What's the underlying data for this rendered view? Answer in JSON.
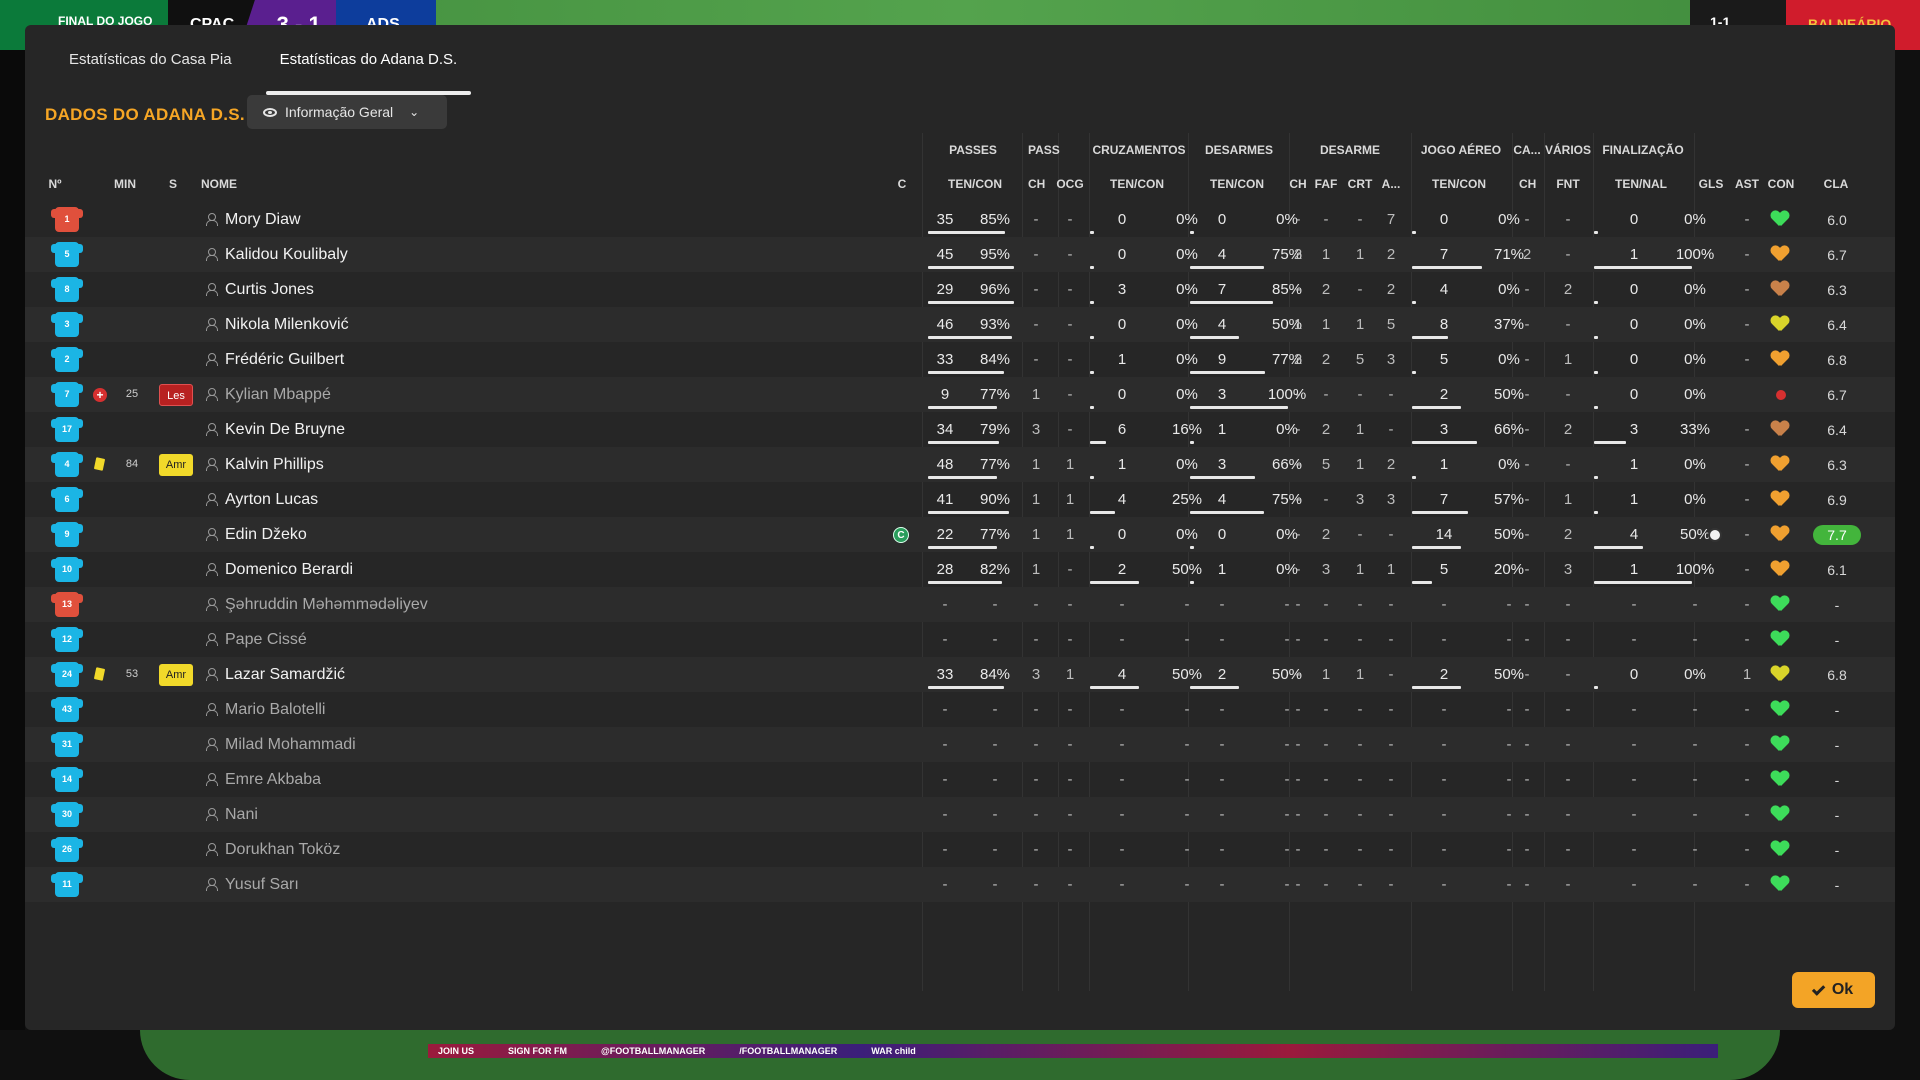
{
  "topbar": {
    "status": "FINAL DO JOGO",
    "home": "CPAC",
    "score": "3 - 1",
    "away": "ADS",
    "right_score": "1-1",
    "room": "BALNEÁRIO"
  },
  "tabs": [
    {
      "label": "Estatísticas do Casa Pia",
      "active": false
    },
    {
      "label": "Estatísticas do Adana D.S.",
      "active": true
    }
  ],
  "section_title": "DADOS DO ADANA D.S.",
  "view_select": "Informação Geral",
  "group_headers": [
    "PASSES",
    "PASSE",
    "CRUZAMENTOS",
    "DESARMES",
    "DESARME",
    "JOGO AÉREO",
    "CA...",
    "VÁRIOS",
    "FINALIZAÇÃO"
  ],
  "column_headers": {
    "num": "Nº",
    "min": "MIN",
    "s": "S",
    "nome": "NOME",
    "c": "C",
    "passes": "TEN/CON",
    "passe_ch": "CH",
    "passe_ocg": "OCG",
    "cruz": "TEN/CON",
    "desarmes": "TEN/CON",
    "desarme_ch": "CH",
    "desarme_faf": "FAF",
    "desarme_crt": "CRT",
    "desarme_a": "A...",
    "aereo": "TEN/CON",
    "ca_ch": "CH",
    "varios_fnt": "FNT",
    "fin": "TEN/NAL",
    "gls": "GLS",
    "ast": "AST",
    "con": "CON",
    "cla": "CLA"
  },
  "players": [
    {
      "num": "1",
      "gk": true,
      "min": "",
      "status": "",
      "name": "Mory Diaw",
      "dim": false,
      "captain": false,
      "pas": [
        "35",
        "85%"
      ],
      "pas_bar": 0.85,
      "ch": "-",
      "ocg": "-",
      "cru": [
        "0",
        "0%"
      ],
      "cru_bar": 0,
      "des": [
        "0",
        "0%"
      ],
      "des_bar": 0,
      "dch": "-",
      "faf": "-",
      "crt": "-",
      "da": "7",
      "aer": [
        "0",
        "0%"
      ],
      "aer_bar": 0,
      "cach": "-",
      "fnt": "-",
      "fin": [
        "0",
        "0%"
      ],
      "fin_bar": 0,
      "gls": "",
      "ast": "-",
      "con": "green",
      "cla": "6.0",
      "top": false
    },
    {
      "num": "5",
      "gk": false,
      "min": "",
      "status": "",
      "name": "Kalidou Koulibaly",
      "dim": false,
      "captain": false,
      "pas": [
        "45",
        "95%"
      ],
      "pas_bar": 0.95,
      "ch": "-",
      "ocg": "-",
      "cru": [
        "0",
        "0%"
      ],
      "cru_bar": 0,
      "des": [
        "4",
        "75%"
      ],
      "des_bar": 0.75,
      "dch": "2",
      "faf": "1",
      "crt": "1",
      "da": "2",
      "aer": [
        "7",
        "71%"
      ],
      "aer_bar": 0.71,
      "cach": "2",
      "fnt": "-",
      "fin": [
        "1",
        "100%"
      ],
      "fin_bar": 1,
      "gls": "",
      "ast": "-",
      "con": "orange",
      "cla": "6.7",
      "top": false
    },
    {
      "num": "8",
      "gk": false,
      "min": "",
      "status": "",
      "name": "Curtis Jones",
      "dim": false,
      "captain": false,
      "pas": [
        "29",
        "96%"
      ],
      "pas_bar": 0.96,
      "ch": "-",
      "ocg": "-",
      "cru": [
        "3",
        "0%"
      ],
      "cru_bar": 0,
      "des": [
        "7",
        "85%"
      ],
      "des_bar": 0.85,
      "dch": "-",
      "faf": "2",
      "crt": "-",
      "da": "2",
      "aer": [
        "4",
        "0%"
      ],
      "aer_bar": 0,
      "cach": "-",
      "fnt": "2",
      "fin": [
        "0",
        "0%"
      ],
      "fin_bar": 0,
      "gls": "",
      "ast": "-",
      "con": "brown",
      "cla": "6.3",
      "top": false
    },
    {
      "num": "3",
      "gk": false,
      "min": "",
      "status": "",
      "name": "Nikola Milenković",
      "dim": false,
      "captain": false,
      "pas": [
        "46",
        "93%"
      ],
      "pas_bar": 0.93,
      "ch": "-",
      "ocg": "-",
      "cru": [
        "0",
        "0%"
      ],
      "cru_bar": 0,
      "des": [
        "4",
        "50%"
      ],
      "des_bar": 0.5,
      "dch": "1",
      "faf": "1",
      "crt": "1",
      "da": "5",
      "aer": [
        "8",
        "37%"
      ],
      "aer_bar": 0.37,
      "cach": "-",
      "fnt": "-",
      "fin": [
        "0",
        "0%"
      ],
      "fin_bar": 0,
      "gls": "",
      "ast": "-",
      "con": "yellow",
      "cla": "6.4",
      "top": false
    },
    {
      "num": "2",
      "gk": false,
      "min": "",
      "status": "",
      "name": "Frédéric Guilbert",
      "dim": false,
      "captain": false,
      "pas": [
        "33",
        "84%"
      ],
      "pas_bar": 0.84,
      "ch": "-",
      "ocg": "-",
      "cru": [
        "1",
        "0%"
      ],
      "cru_bar": 0,
      "des": [
        "9",
        "77%"
      ],
      "des_bar": 0.77,
      "dch": "2",
      "faf": "2",
      "crt": "5",
      "da": "3",
      "aer": [
        "5",
        "0%"
      ],
      "aer_bar": 0,
      "cach": "-",
      "fnt": "1",
      "fin": [
        "0",
        "0%"
      ],
      "fin_bar": 0,
      "gls": "",
      "ast": "-",
      "con": "orange",
      "cla": "6.8",
      "top": false
    },
    {
      "num": "7",
      "gk": false,
      "min": "25",
      "status": "les",
      "name": "Kylian Mbappé",
      "dim": true,
      "captain": false,
      "pas": [
        "9",
        "77%"
      ],
      "pas_bar": 0.77,
      "ch": "1",
      "ocg": "-",
      "cru": [
        "0",
        "0%"
      ],
      "cru_bar": 0,
      "des": [
        "3",
        "100%"
      ],
      "des_bar": 1,
      "dch": "-",
      "faf": "-",
      "crt": "-",
      "da": "-",
      "aer": [
        "2",
        "50%"
      ],
      "aer_bar": 0.5,
      "cach": "-",
      "fnt": "-",
      "fin": [
        "0",
        "0%"
      ],
      "fin_bar": 0,
      "gls": "",
      "ast": "",
      "con": "injured",
      "cla": "6.7",
      "top": false
    },
    {
      "num": "17",
      "gk": false,
      "min": "",
      "status": "",
      "name": "Kevin De Bruyne",
      "dim": false,
      "captain": false,
      "pas": [
        "34",
        "79%"
      ],
      "pas_bar": 0.79,
      "ch": "3",
      "ocg": "-",
      "cru": [
        "6",
        "16%"
      ],
      "cru_bar": 0.16,
      "des": [
        "1",
        "0%"
      ],
      "des_bar": 0,
      "dch": "-",
      "faf": "2",
      "crt": "1",
      "da": "-",
      "aer": [
        "3",
        "66%"
      ],
      "aer_bar": 0.66,
      "cach": "-",
      "fnt": "2",
      "fin": [
        "3",
        "33%"
      ],
      "fin_bar": 0.33,
      "gls": "",
      "ast": "-",
      "con": "brown",
      "cla": "6.4",
      "top": false
    },
    {
      "num": "4",
      "gk": false,
      "min": "84",
      "status": "amr",
      "name": "Kalvin Phillips",
      "dim": false,
      "captain": false,
      "pas": [
        "48",
        "77%"
      ],
      "pas_bar": 0.77,
      "ch": "1",
      "ocg": "1",
      "cru": [
        "1",
        "0%"
      ],
      "cru_bar": 0,
      "des": [
        "3",
        "66%"
      ],
      "des_bar": 0.66,
      "dch": "-",
      "faf": "5",
      "crt": "1",
      "da": "2",
      "aer": [
        "1",
        "0%"
      ],
      "aer_bar": 0,
      "cach": "-",
      "fnt": "-",
      "fin": [
        "1",
        "0%"
      ],
      "fin_bar": 0,
      "gls": "",
      "ast": "-",
      "con": "orange",
      "cla": "6.3",
      "top": false
    },
    {
      "num": "6",
      "gk": false,
      "min": "",
      "status": "",
      "name": "Ayrton Lucas",
      "dim": false,
      "captain": false,
      "pas": [
        "41",
        "90%"
      ],
      "pas_bar": 0.9,
      "ch": "1",
      "ocg": "1",
      "cru": [
        "4",
        "25%"
      ],
      "cru_bar": 0.25,
      "des": [
        "4",
        "75%"
      ],
      "des_bar": 0.75,
      "dch": "-",
      "faf": "-",
      "crt": "3",
      "da": "3",
      "aer": [
        "7",
        "57%"
      ],
      "aer_bar": 0.57,
      "cach": "-",
      "fnt": "1",
      "fin": [
        "1",
        "0%"
      ],
      "fin_bar": 0,
      "gls": "",
      "ast": "-",
      "con": "orange",
      "cla": "6.9",
      "top": false
    },
    {
      "num": "9",
      "gk": false,
      "min": "",
      "status": "",
      "name": "Edin Džeko",
      "dim": false,
      "captain": true,
      "pas": [
        "22",
        "77%"
      ],
      "pas_bar": 0.77,
      "ch": "1",
      "ocg": "1",
      "cru": [
        "0",
        "0%"
      ],
      "cru_bar": 0,
      "des": [
        "0",
        "0%"
      ],
      "des_bar": 0,
      "dch": "-",
      "faf": "2",
      "crt": "-",
      "da": "-",
      "aer": [
        "14",
        "50%"
      ],
      "aer_bar": 0.5,
      "cach": "-",
      "fnt": "2",
      "fin": [
        "4",
        "50%"
      ],
      "fin_bar": 0.5,
      "gls": "ball",
      "ast": "-",
      "con": "orange",
      "cla": "7.7",
      "top": true
    },
    {
      "num": "10",
      "gk": false,
      "min": "",
      "status": "",
      "name": "Domenico Berardi",
      "dim": false,
      "captain": false,
      "pas": [
        "28",
        "82%"
      ],
      "pas_bar": 0.82,
      "ch": "1",
      "ocg": "-",
      "cru": [
        "2",
        "50%"
      ],
      "cru_bar": 0.5,
      "des": [
        "1",
        "0%"
      ],
      "des_bar": 0,
      "dch": "-",
      "faf": "3",
      "crt": "1",
      "da": "1",
      "aer": [
        "5",
        "20%"
      ],
      "aer_bar": 0.2,
      "cach": "-",
      "fnt": "3",
      "fin": [
        "1",
        "100%"
      ],
      "fin_bar": 1,
      "gls": "",
      "ast": "-",
      "con": "orange",
      "cla": "6.1",
      "top": false
    },
    {
      "num": "13",
      "gk": true,
      "min": "",
      "status": "",
      "name": "Şəhruddin Məhəmmədəliyev",
      "dim": true,
      "captain": false,
      "pas": [
        "-",
        "-"
      ],
      "pas_bar": 0,
      "ch": "-",
      "ocg": "-",
      "cru": [
        "-",
        "-"
      ],
      "cru_bar": 0,
      "des": [
        "-",
        "-"
      ],
      "des_bar": 0,
      "dch": "-",
      "faf": "-",
      "crt": "-",
      "da": "-",
      "aer": [
        "-",
        "-"
      ],
      "aer_bar": 0,
      "cach": "-",
      "fnt": "-",
      "fin": [
        "-",
        "-"
      ],
      "fin_bar": 0,
      "gls": "",
      "ast": "-",
      "con": "green",
      "cla": "-",
      "top": false
    },
    {
      "num": "12",
      "gk": false,
      "min": "",
      "status": "",
      "name": "Pape Cissé",
      "dim": true,
      "captain": false,
      "pas": [
        "-",
        "-"
      ],
      "pas_bar": 0,
      "ch": "-",
      "ocg": "-",
      "cru": [
        "-",
        "-"
      ],
      "cru_bar": 0,
      "des": [
        "-",
        "-"
      ],
      "des_bar": 0,
      "dch": "-",
      "faf": "-",
      "crt": "-",
      "da": "-",
      "aer": [
        "-",
        "-"
      ],
      "aer_bar": 0,
      "cach": "-",
      "fnt": "-",
      "fin": [
        "-",
        "-"
      ],
      "fin_bar": 0,
      "gls": "",
      "ast": "-",
      "con": "green",
      "cla": "-",
      "top": false
    },
    {
      "num": "24",
      "gk": false,
      "min": "53",
      "status": "amr",
      "name": "Lazar Samardžić",
      "dim": false,
      "captain": false,
      "pas": [
        "33",
        "84%"
      ],
      "pas_bar": 0.84,
      "ch": "3",
      "ocg": "1",
      "cru": [
        "4",
        "50%"
      ],
      "cru_bar": 0.5,
      "des": [
        "2",
        "50%"
      ],
      "des_bar": 0.5,
      "dch": "-",
      "faf": "1",
      "crt": "1",
      "da": "-",
      "aer": [
        "2",
        "50%"
      ],
      "aer_bar": 0.5,
      "cach": "-",
      "fnt": "-",
      "fin": [
        "0",
        "0%"
      ],
      "fin_bar": 0,
      "gls": "",
      "ast": "1",
      "con": "yellow",
      "cla": "6.8",
      "top": false
    },
    {
      "num": "43",
      "gk": false,
      "min": "",
      "status": "",
      "name": "Mario Balotelli",
      "dim": true,
      "captain": false,
      "pas": [
        "-",
        "-"
      ],
      "pas_bar": 0,
      "ch": "-",
      "ocg": "-",
      "cru": [
        "-",
        "-"
      ],
      "cru_bar": 0,
      "des": [
        "-",
        "-"
      ],
      "des_bar": 0,
      "dch": "-",
      "faf": "-",
      "crt": "-",
      "da": "-",
      "aer": [
        "-",
        "-"
      ],
      "aer_bar": 0,
      "cach": "-",
      "fnt": "-",
      "fin": [
        "-",
        "-"
      ],
      "fin_bar": 0,
      "gls": "",
      "ast": "-",
      "con": "green",
      "cla": "-",
      "top": false
    },
    {
      "num": "31",
      "gk": false,
      "min": "",
      "status": "",
      "name": "Milad Mohammadi",
      "dim": true,
      "captain": false,
      "pas": [
        "-",
        "-"
      ],
      "pas_bar": 0,
      "ch": "-",
      "ocg": "-",
      "cru": [
        "-",
        "-"
      ],
      "cru_bar": 0,
      "des": [
        "-",
        "-"
      ],
      "des_bar": 0,
      "dch": "-",
      "faf": "-",
      "crt": "-",
      "da": "-",
      "aer": [
        "-",
        "-"
      ],
      "aer_bar": 0,
      "cach": "-",
      "fnt": "-",
      "fin": [
        "-",
        "-"
      ],
      "fin_bar": 0,
      "gls": "",
      "ast": "-",
      "con": "green",
      "cla": "-",
      "top": false
    },
    {
      "num": "14",
      "gk": false,
      "min": "",
      "status": "",
      "name": "Emre Akbaba",
      "dim": true,
      "captain": false,
      "pas": [
        "-",
        "-"
      ],
      "pas_bar": 0,
      "ch": "-",
      "ocg": "-",
      "cru": [
        "-",
        "-"
      ],
      "cru_bar": 0,
      "des": [
        "-",
        "-"
      ],
      "des_bar": 0,
      "dch": "-",
      "faf": "-",
      "crt": "-",
      "da": "-",
      "aer": [
        "-",
        "-"
      ],
      "aer_bar": 0,
      "cach": "-",
      "fnt": "-",
      "fin": [
        "-",
        "-"
      ],
      "fin_bar": 0,
      "gls": "",
      "ast": "-",
      "con": "green",
      "cla": "-",
      "top": false
    },
    {
      "num": "30",
      "gk": false,
      "min": "",
      "status": "",
      "name": "Nani",
      "dim": true,
      "captain": false,
      "pas": [
        "-",
        "-"
      ],
      "pas_bar": 0,
      "ch": "-",
      "ocg": "-",
      "cru": [
        "-",
        "-"
      ],
      "cru_bar": 0,
      "des": [
        "-",
        "-"
      ],
      "des_bar": 0,
      "dch": "-",
      "faf": "-",
      "crt": "-",
      "da": "-",
      "aer": [
        "-",
        "-"
      ],
      "aer_bar": 0,
      "cach": "-",
      "fnt": "-",
      "fin": [
        "-",
        "-"
      ],
      "fin_bar": 0,
      "gls": "",
      "ast": "-",
      "con": "green",
      "cla": "-",
      "top": false
    },
    {
      "num": "26",
      "gk": false,
      "min": "",
      "status": "",
      "name": "Dorukhan Toköz",
      "dim": true,
      "captain": false,
      "pas": [
        "-",
        "-"
      ],
      "pas_bar": 0,
      "ch": "-",
      "ocg": "-",
      "cru": [
        "-",
        "-"
      ],
      "cru_bar": 0,
      "des": [
        "-",
        "-"
      ],
      "des_bar": 0,
      "dch": "-",
      "faf": "-",
      "crt": "-",
      "da": "-",
      "aer": [
        "-",
        "-"
      ],
      "aer_bar": 0,
      "cach": "-",
      "fnt": "-",
      "fin": [
        "-",
        "-"
      ],
      "fin_bar": 0,
      "gls": "",
      "ast": "-",
      "con": "green",
      "cla": "-",
      "top": false
    },
    {
      "num": "11",
      "gk": false,
      "min": "",
      "status": "",
      "name": "Yusuf Sarı",
      "dim": true,
      "captain": false,
      "pas": [
        "-",
        "-"
      ],
      "pas_bar": 0,
      "ch": "-",
      "ocg": "-",
      "cru": [
        "-",
        "-"
      ],
      "cru_bar": 0,
      "des": [
        "-",
        "-"
      ],
      "des_bar": 0,
      "dch": "-",
      "faf": "-",
      "crt": "-",
      "da": "-",
      "aer": [
        "-",
        "-"
      ],
      "aer_bar": 0,
      "cach": "-",
      "fnt": "-",
      "fin": [
        "-",
        "-"
      ],
      "fin_bar": 0,
      "gls": "",
      "ast": "-",
      "con": "green",
      "cla": "-",
      "top": false
    }
  ],
  "status_labels": {
    "les": "Les",
    "amr": "Amr"
  },
  "captain_label": "C",
  "ad_strip": [
    "JOIN US",
    "SIGN FOR FM",
    "@FOOTBALLMANAGER",
    "/FOOTBALLMANAGER",
    "WAR child"
  ],
  "ok_label": "Ok",
  "colors": {
    "accent": "#f6a625",
    "shirt_outfield": "#1bb5e5",
    "shirt_gk": "#e0503c",
    "top_rating": "#43b53c",
    "yellow_card": "#f1d92a",
    "injury": "#d63030"
  }
}
